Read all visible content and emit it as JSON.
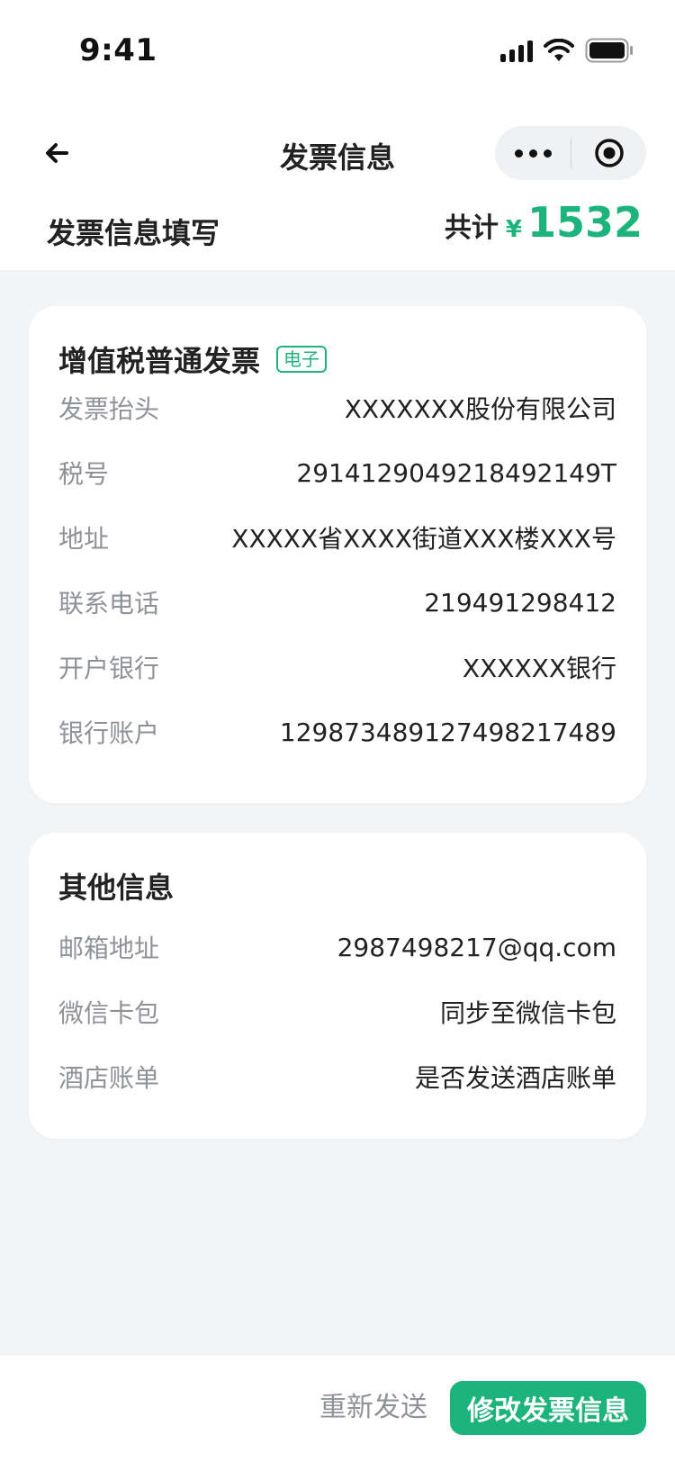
{
  "status_bar": {
    "time": "9:41"
  },
  "nav": {
    "title": "发票信息"
  },
  "summary": {
    "form_title": "发票信息填写",
    "total_label": "共计",
    "currency": "¥",
    "amount": "1532"
  },
  "invoice_card": {
    "title": "增值税普通发票",
    "tag": "电子",
    "rows": [
      {
        "label": "发票抬头",
        "value": "XXXXXXX股份有限公司"
      },
      {
        "label": "税号",
        "value": "2914129049218492149T"
      },
      {
        "label": "地址",
        "value": "XXXXX省XXXX街道XXX楼XXX号"
      },
      {
        "label": "联系电话",
        "value": "219491298412"
      },
      {
        "label": "开户银行",
        "value": "XXXXXX银行"
      },
      {
        "label": "银行账户",
        "value": "129873489127498217489"
      }
    ]
  },
  "other_card": {
    "title": "其他信息",
    "rows": [
      {
        "label": "邮箱地址",
        "value": "2987498217@qq.com"
      },
      {
        "label": "微信卡包",
        "value": "同步至微信卡包"
      },
      {
        "label": "酒店账单",
        "value": "是否发送酒店账单"
      }
    ]
  },
  "actions": {
    "resend_label": "重新发送",
    "modify_label": "修改发票信息"
  },
  "colors": {
    "accent": "#1db37c",
    "background": "#f3f4f6",
    "label_gray": "#8f9296"
  },
  "icons": {
    "back": "arrow-left-icon",
    "more": "more-dots-icon",
    "close": "target-circle-icon",
    "signal": "signal-icon",
    "wifi": "wifi-icon",
    "battery": "battery-icon"
  }
}
